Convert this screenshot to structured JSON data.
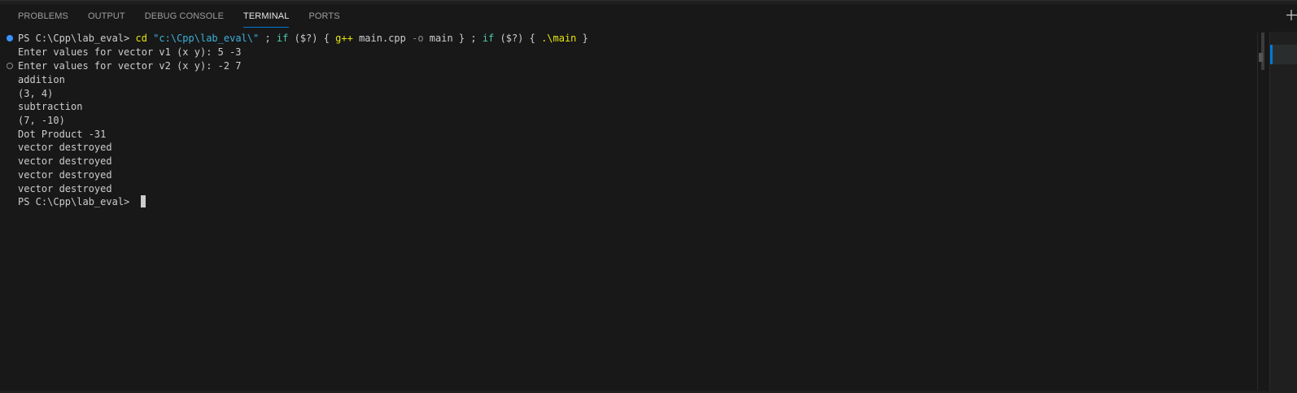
{
  "panel": {
    "tabs": [
      {
        "label": "PROBLEMS",
        "active": false
      },
      {
        "label": "OUTPUT",
        "active": false
      },
      {
        "label": "DEBUG CONSOLE",
        "active": false
      },
      {
        "label": "TERMINAL",
        "active": true
      },
      {
        "label": "PORTS",
        "active": false
      }
    ],
    "new_terminal_icon": "plus-icon",
    "accent_color": "#0078d4"
  },
  "terminal": {
    "command": {
      "prompt": "PS C:\\Cpp\\lab_eval> ",
      "cd": "cd",
      "path_string": "\"c:\\Cpp\\lab_eval\\\"",
      "sep1": " ; ",
      "if1": "if",
      "cond1": " ($?) { ",
      "compiler": "g++",
      "source": " main.cpp ",
      "flag": "-o",
      "target": " main } ; ",
      "if2": "if",
      "cond2": " ($?) { ",
      "run": ".\\main",
      "close": " }"
    },
    "output_lines": [
      "Enter values for vector v1 (x y): 5 -3",
      "Enter values for vector v2 (x y): -2 7",
      "addition",
      "(3, 4)",
      "subtraction",
      "(7, -10)",
      "Dot Product -31",
      "vector destroyed",
      "vector destroyed",
      "vector destroyed",
      "vector destroyed"
    ],
    "final_prompt": "PS C:\\Cpp\\lab_eval> ",
    "decorations": {
      "success_color": "#3794ff",
      "pending_color": "#8a8a8a"
    },
    "colors": {
      "text": "#cccccc",
      "command": "#e5e510",
      "string": "#3bb0d8",
      "keyword": "#4ec9b0",
      "parameter": "#8a8a8a",
      "background": "#181818"
    }
  }
}
